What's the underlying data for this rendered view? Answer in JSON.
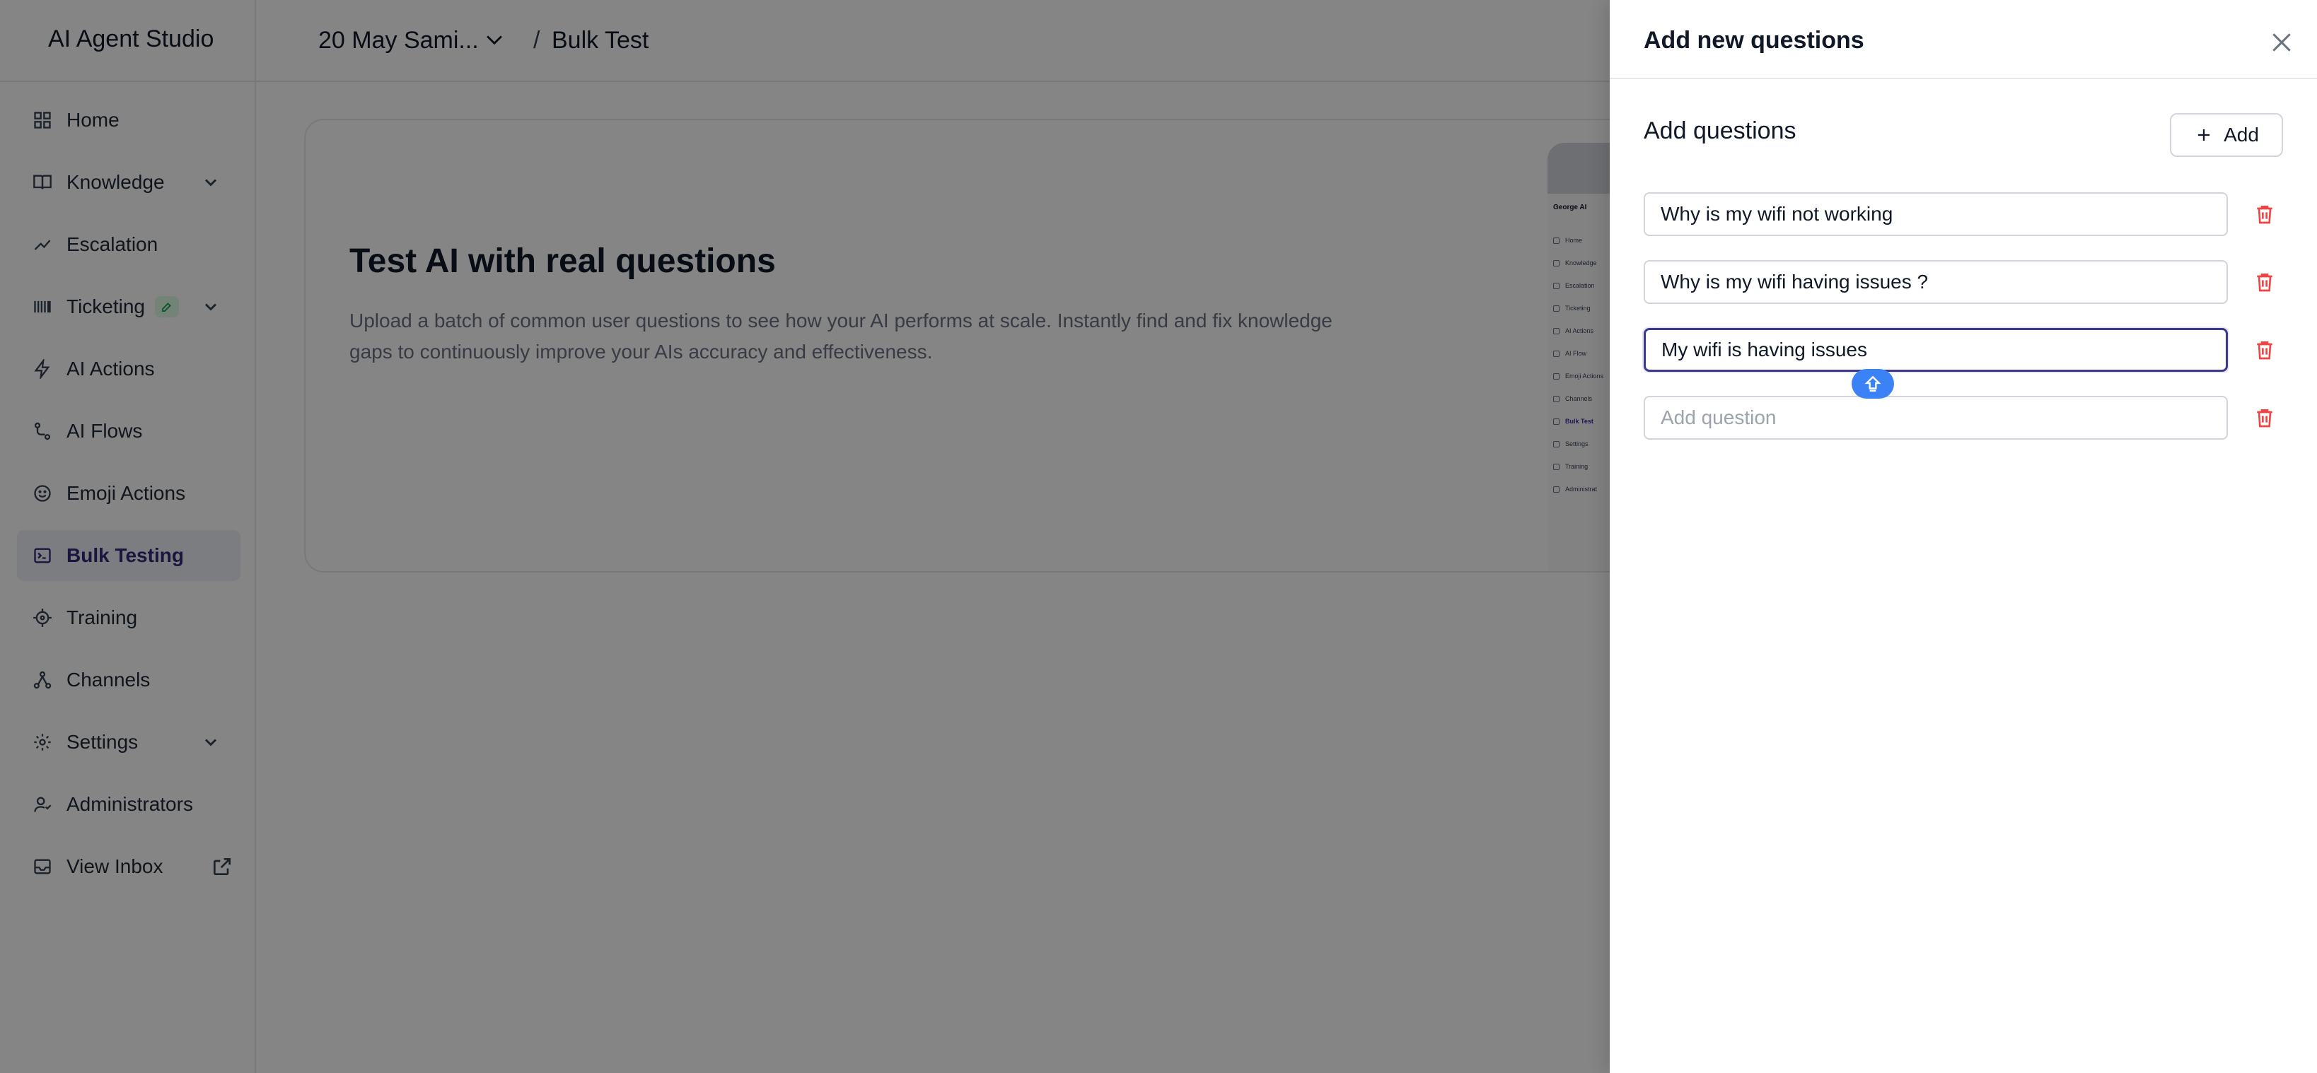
{
  "app": {
    "brand": "AI Agent Studio"
  },
  "sidebar": {
    "items": [
      {
        "label": "Home",
        "icon": "grid-icon"
      },
      {
        "label": "Knowledge",
        "icon": "book-icon"
      },
      {
        "label": "Escalation",
        "icon": "trend-up-icon"
      },
      {
        "label": "Ticketing",
        "icon": "barcode-icon"
      },
      {
        "label": "AI Actions",
        "icon": "bolt-icon"
      },
      {
        "label": "AI Flows",
        "icon": "flow-icon"
      },
      {
        "label": "Emoji Actions",
        "icon": "smiley-icon"
      },
      {
        "label": "Bulk Testing",
        "icon": "terminal-icon",
        "active": true
      },
      {
        "label": "Training",
        "icon": "target-icon"
      },
      {
        "label": "Channels",
        "icon": "nodes-icon"
      },
      {
        "label": "Settings",
        "icon": "gear-icon"
      },
      {
        "label": "Administrators",
        "icon": "users-icon"
      },
      {
        "label": "View Inbox",
        "icon": "inbox-icon"
      }
    ]
  },
  "breadcrumb": {
    "project": "20 May Sami...",
    "separator": "/",
    "page": "Bulk Test"
  },
  "hero": {
    "title": "Test AI with real questions",
    "description": "Upload a batch of common user questions to see how your AI performs at scale. Instantly find and fix knowledge gaps to continuously improve your AIs accuracy and effectiveness."
  },
  "preview": {
    "brand": "George AI",
    "items": [
      "Home",
      "Knowledge",
      "Escalation",
      "Ticketing",
      "AI Actions",
      "AI Flow",
      "Emoji Actions",
      "Channels",
      "Bulk Test",
      "Settings",
      "Training",
      "Administrat"
    ]
  },
  "drawer": {
    "title": "Add new questions",
    "section_title": "Add questions",
    "add_label": "Add",
    "questions": [
      {
        "value": "Why is my wifi not working",
        "placeholder": "Add question"
      },
      {
        "value": "Why is my wifi having issues ?",
        "placeholder": "Add question"
      },
      {
        "value": "My wifi is having issues",
        "placeholder": "Add question"
      },
      {
        "value": "",
        "placeholder": "Add question"
      }
    ]
  },
  "colors": {
    "accent": "#3b3a8f",
    "danger": "#ef4444",
    "active_bg": "#eef0f6",
    "caret_handle": "#3b82f6"
  }
}
